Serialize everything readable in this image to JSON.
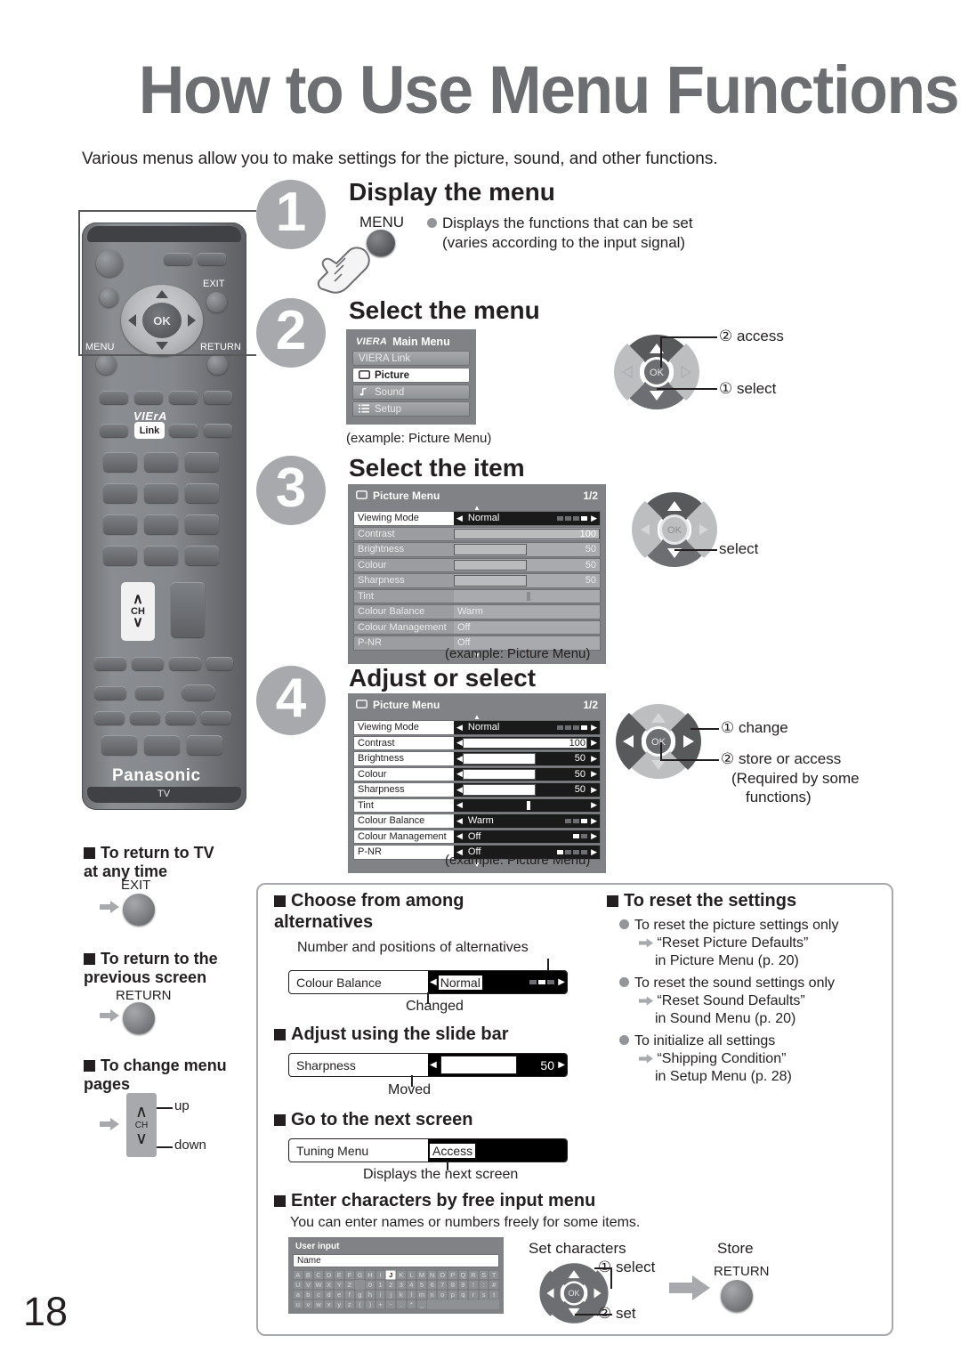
{
  "page": {
    "title": "How to Use Menu Functions",
    "intro": "Various menus allow you to make settings for the picture, sound, and other functions.",
    "page_number": "18",
    "brand": "Panasonic",
    "device_label": "TV"
  },
  "steps": [
    {
      "number": "1",
      "title": "Display the menu",
      "button_label": "MENU",
      "bullet": "Displays the functions that can be set",
      "bullet_sub": "(varies according to the input signal)"
    },
    {
      "number": "2",
      "title": "Select the menu",
      "caption": "(example: Picture Menu)",
      "pad_labels": [
        "② access",
        "① select"
      ]
    },
    {
      "number": "3",
      "title": "Select the item",
      "caption": "(example: Picture Menu)",
      "pad_labels": [
        "select"
      ]
    },
    {
      "number": "4",
      "title": "Adjust or select",
      "caption": "(example: Picture Menu)",
      "pad_labels": [
        "① change",
        "② store or access",
        "(Required by some",
        "functions)"
      ]
    }
  ],
  "main_menu": {
    "brand": "VIERA",
    "title": "Main Menu",
    "items": [
      {
        "label": "VIERA Link",
        "icon": "none",
        "selected": false
      },
      {
        "label": "Picture",
        "icon": "picture-icon",
        "selected": true
      },
      {
        "label": "Sound",
        "icon": "note-icon",
        "selected": false
      },
      {
        "label": "Setup",
        "icon": "list-icon",
        "selected": false
      }
    ]
  },
  "picture_menu": {
    "title": "Picture Menu",
    "page_indicator": "1/2",
    "rows": [
      {
        "label": "Viewing Mode",
        "value": "Normal",
        "type": "options",
        "dashes": 4,
        "dash_on": 1,
        "selected": true
      },
      {
        "label": "Contrast",
        "value": "100",
        "type": "slider",
        "fill": 100
      },
      {
        "label": "Brightness",
        "value": "50",
        "type": "slider",
        "fill": 50
      },
      {
        "label": "Colour",
        "value": "50",
        "type": "slider",
        "fill": 50
      },
      {
        "label": "Sharpness",
        "value": "50",
        "type": "slider",
        "fill": 50
      },
      {
        "label": "Tint",
        "value": "",
        "type": "centered",
        "fill": 50
      },
      {
        "label": "Colour Balance",
        "value": "Warm",
        "type": "options",
        "dashes": 3,
        "dash_on": 3
      },
      {
        "label": "Colour Management",
        "value": "Off",
        "type": "options",
        "dashes": 2,
        "dash_on": 1
      },
      {
        "label": "P-NR",
        "value": "Off",
        "type": "options",
        "dashes": 4,
        "dash_on": 1
      }
    ]
  },
  "left_notes": [
    {
      "heading": "To return to TV\nat any time",
      "button": "EXIT"
    },
    {
      "heading": "To return to the\nprevious screen",
      "button": "RETURN"
    },
    {
      "heading": "To change menu\npages",
      "button": "CH",
      "up": "up",
      "down": "down"
    }
  ],
  "bottom": {
    "choose": {
      "heading": "Choose from among\nalternatives",
      "caption_top": "Number and positions of alternatives",
      "caption_bottom": "Changed",
      "bar": {
        "label": "Colour Balance",
        "value": "Normal",
        "dashes": 3,
        "dash_on": 2
      }
    },
    "slide": {
      "heading": "Adjust using the slide bar",
      "caption": "Moved",
      "bar": {
        "label": "Sharpness",
        "value": "50",
        "fill": 50
      }
    },
    "next": {
      "heading": "Go to the next screen",
      "caption": "Displays the next screen",
      "bar": {
        "label": "Tuning Menu",
        "value": "Access"
      }
    },
    "chars": {
      "heading": "Enter characters by free input menu",
      "subtitle": "You can enter names or numbers freely for some items.",
      "osd_title": "User input",
      "field_label": "Name",
      "set_label": "Set characters",
      "store_label": "Store",
      "store_button": "RETURN",
      "pad_labels": [
        "① select",
        "② set"
      ],
      "keyboard": [
        [
          "A",
          "B",
          "C",
          "D",
          "E",
          "F",
          "G",
          "H",
          "I",
          "J",
          "K",
          "L",
          "M",
          "N",
          "O",
          "P",
          "Q",
          "R",
          "S",
          "T"
        ],
        [
          "U",
          "V",
          "W",
          "X",
          "Y",
          "Z",
          "",
          "0",
          "1",
          "2",
          "3",
          "4",
          "5",
          "6",
          "7",
          "8",
          "9",
          "!",
          ":",
          "#"
        ],
        [
          "a",
          "b",
          "c",
          "d",
          "e",
          "f",
          "g",
          "h",
          "i",
          "j",
          "k",
          "l",
          "m",
          "n",
          "o",
          "p",
          "q",
          "r",
          "s",
          "t"
        ],
        [
          "u",
          "v",
          "w",
          "x",
          "y",
          "z",
          "(",
          ")",
          "+",
          "-",
          ".",
          "*",
          "_",
          "",
          "",
          "",
          "",
          "",
          "",
          ""
        ]
      ],
      "highlight_key": "J"
    },
    "reset": {
      "heading": "To reset the settings",
      "items": [
        {
          "bullet": "To reset the picture settings only",
          "arrow1": "“Reset Picture Defaults”",
          "arrow2": "in Picture Menu (p. 20)"
        },
        {
          "bullet": "To reset the sound settings only",
          "arrow1": "“Reset Sound Defaults”",
          "arrow2": "in Sound Menu (p. 20)"
        },
        {
          "bullet": "To initialize all settings",
          "arrow1": "“Shipping Condition”",
          "arrow2": "in Setup Menu (p. 28)"
        }
      ]
    }
  },
  "colors": {
    "title_gray": "#6d6e71",
    "step_badge": "#a7a9ac",
    "osd_bg": "#808285",
    "panel_border": "#a7a9ac"
  }
}
